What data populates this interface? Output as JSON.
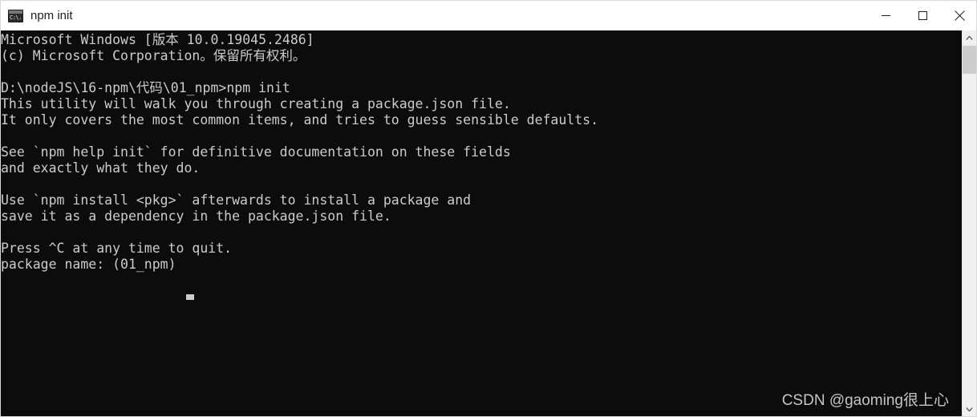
{
  "window": {
    "title": "npm init",
    "icon": "cmd-console-icon",
    "icon_glyph": "C:\\.",
    "background_color": "#0c0c0c",
    "text_color": "#cccccc",
    "titlebar_color": "#ffffff"
  },
  "controls": {
    "minimize_label": "Minimize",
    "maximize_label": "Maximize",
    "close_label": "Close"
  },
  "console": {
    "lines": [
      "Microsoft Windows [版本 10.0.19045.2486]",
      "(c) Microsoft Corporation。保留所有权利。",
      "",
      "D:\\nodeJS\\16-npm\\代码\\01_npm>npm init",
      "This utility will walk you through creating a package.json file.",
      "It only covers the most common items, and tries to guess sensible defaults.",
      "",
      "See `npm help init` for definitive documentation on these fields",
      "and exactly what they do.",
      "",
      "Use `npm install <pkg>` afterwards to install a package and",
      "save it as a dependency in the package.json file.",
      "",
      "Press ^C at any time to quit.",
      "package name: (01_npm) "
    ],
    "prompt_path": "D:\\nodeJS\\16-npm\\代码\\01_npm>",
    "command": "npm init",
    "current_question": "package name:",
    "current_default": "(01_npm)",
    "cursor": "block-underscore"
  },
  "watermark": {
    "text": "CSDN @gaoming很上心"
  },
  "scrollbar": {
    "up_arrow": "chevron-up-icon",
    "down_arrow": "chevron-down-icon",
    "thumb_color": "#cdcdcd",
    "track_color": "#f0f0f0"
  }
}
